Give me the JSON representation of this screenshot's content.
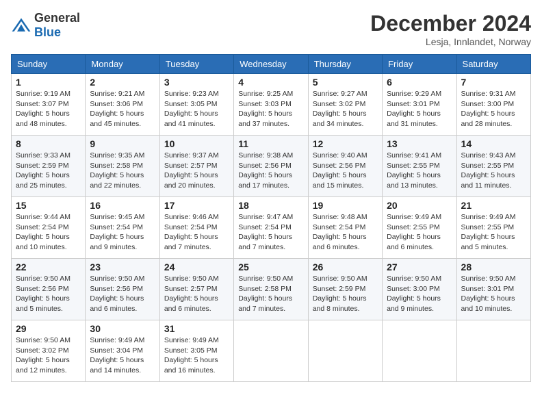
{
  "header": {
    "logo_general": "General",
    "logo_blue": "Blue",
    "month_title": "December 2024",
    "location": "Lesja, Innlandet, Norway"
  },
  "columns": [
    "Sunday",
    "Monday",
    "Tuesday",
    "Wednesday",
    "Thursday",
    "Friday",
    "Saturday"
  ],
  "weeks": [
    [
      {
        "day": "1",
        "sunrise": "Sunrise: 9:19 AM",
        "sunset": "Sunset: 3:07 PM",
        "daylight": "Daylight: 5 hours and 48 minutes."
      },
      {
        "day": "2",
        "sunrise": "Sunrise: 9:21 AM",
        "sunset": "Sunset: 3:06 PM",
        "daylight": "Daylight: 5 hours and 45 minutes."
      },
      {
        "day": "3",
        "sunrise": "Sunrise: 9:23 AM",
        "sunset": "Sunset: 3:05 PM",
        "daylight": "Daylight: 5 hours and 41 minutes."
      },
      {
        "day": "4",
        "sunrise": "Sunrise: 9:25 AM",
        "sunset": "Sunset: 3:03 PM",
        "daylight": "Daylight: 5 hours and 37 minutes."
      },
      {
        "day": "5",
        "sunrise": "Sunrise: 9:27 AM",
        "sunset": "Sunset: 3:02 PM",
        "daylight": "Daylight: 5 hours and 34 minutes."
      },
      {
        "day": "6",
        "sunrise": "Sunrise: 9:29 AM",
        "sunset": "Sunset: 3:01 PM",
        "daylight": "Daylight: 5 hours and 31 minutes."
      },
      {
        "day": "7",
        "sunrise": "Sunrise: 9:31 AM",
        "sunset": "Sunset: 3:00 PM",
        "daylight": "Daylight: 5 hours and 28 minutes."
      }
    ],
    [
      {
        "day": "8",
        "sunrise": "Sunrise: 9:33 AM",
        "sunset": "Sunset: 2:59 PM",
        "daylight": "Daylight: 5 hours and 25 minutes."
      },
      {
        "day": "9",
        "sunrise": "Sunrise: 9:35 AM",
        "sunset": "Sunset: 2:58 PM",
        "daylight": "Daylight: 5 hours and 22 minutes."
      },
      {
        "day": "10",
        "sunrise": "Sunrise: 9:37 AM",
        "sunset": "Sunset: 2:57 PM",
        "daylight": "Daylight: 5 hours and 20 minutes."
      },
      {
        "day": "11",
        "sunrise": "Sunrise: 9:38 AM",
        "sunset": "Sunset: 2:56 PM",
        "daylight": "Daylight: 5 hours and 17 minutes."
      },
      {
        "day": "12",
        "sunrise": "Sunrise: 9:40 AM",
        "sunset": "Sunset: 2:56 PM",
        "daylight": "Daylight: 5 hours and 15 minutes."
      },
      {
        "day": "13",
        "sunrise": "Sunrise: 9:41 AM",
        "sunset": "Sunset: 2:55 PM",
        "daylight": "Daylight: 5 hours and 13 minutes."
      },
      {
        "day": "14",
        "sunrise": "Sunrise: 9:43 AM",
        "sunset": "Sunset: 2:55 PM",
        "daylight": "Daylight: 5 hours and 11 minutes."
      }
    ],
    [
      {
        "day": "15",
        "sunrise": "Sunrise: 9:44 AM",
        "sunset": "Sunset: 2:54 PM",
        "daylight": "Daylight: 5 hours and 10 minutes."
      },
      {
        "day": "16",
        "sunrise": "Sunrise: 9:45 AM",
        "sunset": "Sunset: 2:54 PM",
        "daylight": "Daylight: 5 hours and 9 minutes."
      },
      {
        "day": "17",
        "sunrise": "Sunrise: 9:46 AM",
        "sunset": "Sunset: 2:54 PM",
        "daylight": "Daylight: 5 hours and 7 minutes."
      },
      {
        "day": "18",
        "sunrise": "Sunrise: 9:47 AM",
        "sunset": "Sunset: 2:54 PM",
        "daylight": "Daylight: 5 hours and 7 minutes."
      },
      {
        "day": "19",
        "sunrise": "Sunrise: 9:48 AM",
        "sunset": "Sunset: 2:54 PM",
        "daylight": "Daylight: 5 hours and 6 minutes."
      },
      {
        "day": "20",
        "sunrise": "Sunrise: 9:49 AM",
        "sunset": "Sunset: 2:55 PM",
        "daylight": "Daylight: 5 hours and 6 minutes."
      },
      {
        "day": "21",
        "sunrise": "Sunrise: 9:49 AM",
        "sunset": "Sunset: 2:55 PM",
        "daylight": "Daylight: 5 hours and 5 minutes."
      }
    ],
    [
      {
        "day": "22",
        "sunrise": "Sunrise: 9:50 AM",
        "sunset": "Sunset: 2:56 PM",
        "daylight": "Daylight: 5 hours and 5 minutes."
      },
      {
        "day": "23",
        "sunrise": "Sunrise: 9:50 AM",
        "sunset": "Sunset: 2:56 PM",
        "daylight": "Daylight: 5 hours and 6 minutes."
      },
      {
        "day": "24",
        "sunrise": "Sunrise: 9:50 AM",
        "sunset": "Sunset: 2:57 PM",
        "daylight": "Daylight: 5 hours and 6 minutes."
      },
      {
        "day": "25",
        "sunrise": "Sunrise: 9:50 AM",
        "sunset": "Sunset: 2:58 PM",
        "daylight": "Daylight: 5 hours and 7 minutes."
      },
      {
        "day": "26",
        "sunrise": "Sunrise: 9:50 AM",
        "sunset": "Sunset: 2:59 PM",
        "daylight": "Daylight: 5 hours and 8 minutes."
      },
      {
        "day": "27",
        "sunrise": "Sunrise: 9:50 AM",
        "sunset": "Sunset: 3:00 PM",
        "daylight": "Daylight: 5 hours and 9 minutes."
      },
      {
        "day": "28",
        "sunrise": "Sunrise: 9:50 AM",
        "sunset": "Sunset: 3:01 PM",
        "daylight": "Daylight: 5 hours and 10 minutes."
      }
    ],
    [
      {
        "day": "29",
        "sunrise": "Sunrise: 9:50 AM",
        "sunset": "Sunset: 3:02 PM",
        "daylight": "Daylight: 5 hours and 12 minutes."
      },
      {
        "day": "30",
        "sunrise": "Sunrise: 9:49 AM",
        "sunset": "Sunset: 3:04 PM",
        "daylight": "Daylight: 5 hours and 14 minutes."
      },
      {
        "day": "31",
        "sunrise": "Sunrise: 9:49 AM",
        "sunset": "Sunset: 3:05 PM",
        "daylight": "Daylight: 5 hours and 16 minutes."
      },
      null,
      null,
      null,
      null
    ]
  ]
}
